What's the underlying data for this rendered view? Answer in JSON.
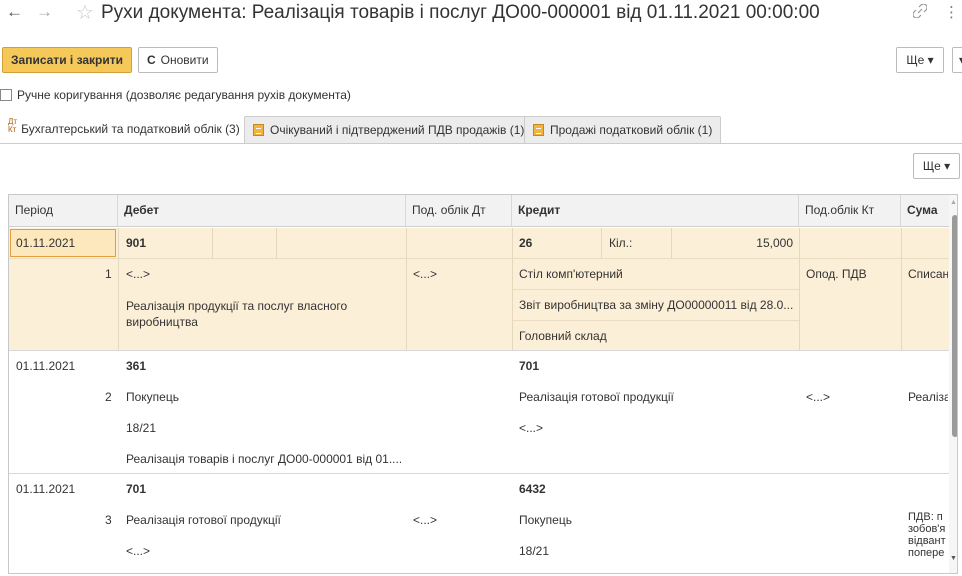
{
  "header": {
    "title": "Рухи документа: Реалізація товарів і послуг ДО00-000001 від 01.11.2021 00:00:00",
    "back_glyph": "←",
    "forward_glyph": "→",
    "star_glyph": "☆",
    "link_glyph": "🔗",
    "more_glyph": "⋮"
  },
  "toolbar": {
    "save_close": "Записати і закрити",
    "refresh": "Оновити",
    "refresh_glyph": "C",
    "more": "Ще ▾",
    "edge": "▾"
  },
  "manual": {
    "label": "Ручне коригування (дозволяє редагування рухів документа)",
    "checked": false
  },
  "tabs": [
    {
      "label": "Бухгалтерський та податковий облік (3)",
      "icon": "dt-kt-icon",
      "active": true
    },
    {
      "label": "Очікуваний і підтверджений ПДВ продажів (1)",
      "icon": "register-icon",
      "active": false
    },
    {
      "label": "Продажі податковий облік (1)",
      "icon": "register-icon",
      "active": false
    }
  ],
  "grid_more": "Ще ▾",
  "dtkt": {
    "top": "Дт",
    "bottom": "Кт"
  },
  "columns": {
    "period": "Період",
    "debit": "Дебет",
    "tax_dt": "Под. облік Дт",
    "credit": "Кредит",
    "tax_kt": "Под.облік Кт",
    "sum": "Сума"
  },
  "rows": [
    {
      "period": "01.11.2021",
      "num": "1",
      "debit_account": "901",
      "debit_lines": [
        "<...>",
        "Реалізація продукції та послуг власного виробництва"
      ],
      "tax_dt": "<...>",
      "credit_account": "26",
      "qty_label": "Кіл.:",
      "qty": "15,000",
      "credit_lines": [
        "Стіл комп'ютерний",
        "Звіт виробництва за зміну ДО00000011 від 28.0...",
        "Головний склад"
      ],
      "tax_kt": "Опод. ПДВ",
      "sum": "Списан"
    },
    {
      "period": "01.11.2021",
      "num": "2",
      "debit_account": "361",
      "debit_lines": [
        "Покупець",
        "18/21",
        "Реалізація товарів і послуг ДО00-000001 від 01...."
      ],
      "credit_account": "701",
      "credit_lines": [
        "Реалізація готової продукції",
        "<...>"
      ],
      "tax_kt": "<...>",
      "sum": "Реаліза"
    },
    {
      "period": "01.11.2021",
      "num": "3",
      "debit_account": "701",
      "debit_lines": [
        "Реалізація готової продукції",
        "<...>"
      ],
      "tax_dt": "<...>",
      "credit_account": "6432",
      "credit_lines": [
        "Покупець",
        "18/21"
      ],
      "sum_lines": [
        "ПДВ: п",
        "зобов'я",
        "відвант",
        "поперe"
      ]
    }
  ]
}
